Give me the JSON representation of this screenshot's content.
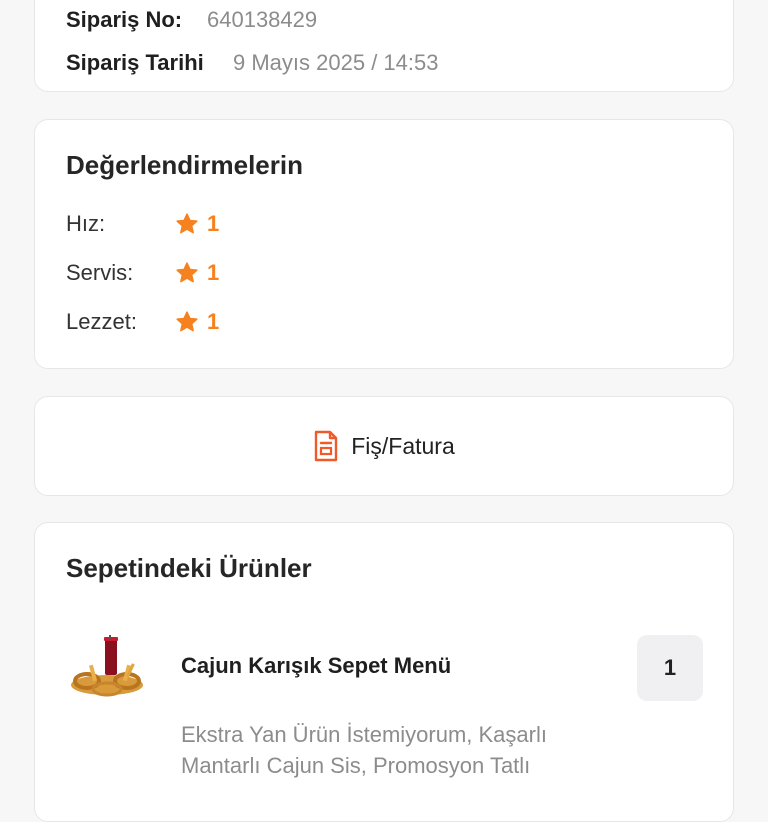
{
  "order": {
    "number_label": "Sipariş No:",
    "number_value": "640138429",
    "date_label": "Sipariş Tarihi",
    "date_value": "9 Mayıs 2025 / 14:53"
  },
  "ratings": {
    "title": "Değerlendirmelerin",
    "items": [
      {
        "label": "Hız:",
        "value": "1"
      },
      {
        "label": "Servis:",
        "value": "1"
      },
      {
        "label": "Lezzet:",
        "value": "1"
      }
    ],
    "star_icon": "star-icon",
    "star_color": "#f5821f"
  },
  "receipt": {
    "label": "Fiş/Fatura",
    "icon": "receipt-icon",
    "icon_color": "#f05a28"
  },
  "basket": {
    "title": "Sepetindeki Ürünler",
    "items": [
      {
        "name": "Cajun Karışık Sepet Menü",
        "quantity": "1",
        "description": "Ekstra Yan Ürün İstemiyorum, Kaşarlı Mantarlı Cajun Sis, Promosyon Tatlı"
      }
    ]
  }
}
